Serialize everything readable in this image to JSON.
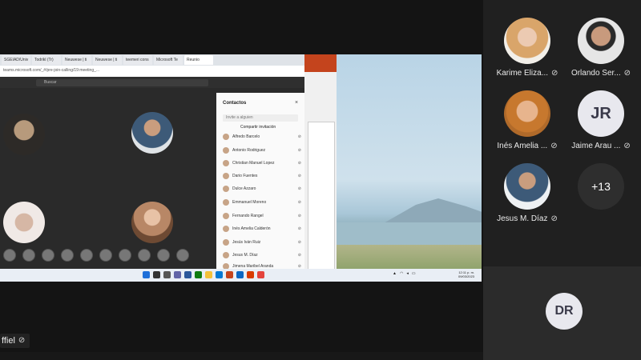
{
  "browser": {
    "tabs": [
      "SGEIAD/Univ",
      "Todrikl (Tr)",
      "Neuwese | ti",
      "Neuwese | ti",
      "teemeri cons",
      "Microsoft Te",
      "Reunio"
    ],
    "url": "teams.microsoft.com/_#/pre-join-calling/19:meeting_...",
    "search_placeholder": "Buscar"
  },
  "contacts": {
    "title": "Contactos",
    "close": "×",
    "invite_placeholder": "Invite a alguien",
    "share_invite": "Compartir invitación",
    "items": [
      "Alfredo Barcelo",
      "Antonio Rodriguez",
      "Christian Manuel Lopez",
      "Dario Fuentes",
      "Dulce Azzaro",
      "Emmanuel Moreno",
      "Fernando Rangel",
      "Inés Amelia Calderón",
      "Jesús Iván Ruiz",
      "Jesus M. Díaz",
      "Jimena Maribel Aranda"
    ]
  },
  "taskbar": {
    "clock_time": "12:11 p. m.",
    "clock_date": "09/03/2023"
  },
  "presenter": {
    "name": "ffiel",
    "mic": "🎙̸"
  },
  "gallery": {
    "participants": [
      {
        "name": "Karime Eliza...",
        "type": "photo"
      },
      {
        "name": "Orlando Ser...",
        "type": "photo"
      },
      {
        "name": "Inés Amelia ...",
        "type": "photo"
      },
      {
        "name": "Jaime Arau ...",
        "type": "initials",
        "initials": "JR"
      },
      {
        "name": "Jesus M. Díaz",
        "type": "photo"
      },
      {
        "name": "",
        "type": "more",
        "label": "+13"
      }
    ],
    "dr_tile": {
      "initials": "DR"
    }
  },
  "colors": {
    "accent": "#c4441d",
    "gallery_bg": "#202020",
    "initials_bg": "#e8e8ee"
  }
}
